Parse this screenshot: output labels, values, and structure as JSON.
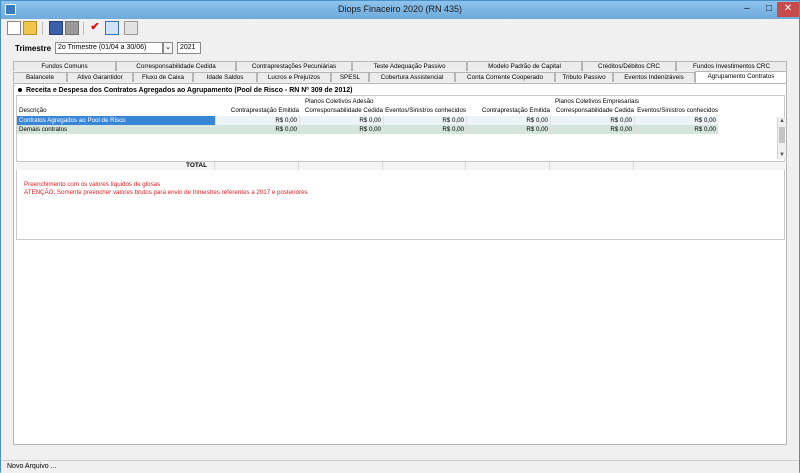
{
  "window": {
    "title": "Diops Finaceiro 2020 (RN 435)",
    "controls": {
      "minimize": "–",
      "maximize": "□",
      "close": "✕"
    }
  },
  "toolbar": {
    "icons": [
      "new-file-icon",
      "open-folder-icon",
      "save-icon",
      "stop-icon",
      "check-icon",
      "export-icon",
      "grid-icon"
    ]
  },
  "filter": {
    "label": "Trimestre",
    "quarter": "2o Trimestre (01/04 a 30/06)",
    "year": "2021"
  },
  "tabs": {
    "row1": [
      "Fundos Comuns",
      "Corresponsabilidade Cedida",
      "Contraprestações Pecuniárias",
      "Teste Adequação Passivo",
      "Modelo Padrão de Capital",
      "Créditos/Débitos CRC",
      "Fundos Investimentos CRC"
    ],
    "row2": [
      "Balancete",
      "Ativo Garantidor",
      "Fluxo de Caixa",
      "Idade Saldos",
      "Lucros e Prejuízos",
      "SPESL",
      "Cobertura Assistencial",
      "Conta Corrente Cooperado",
      "Tributo Passivo",
      "Eventos Indenizáveis",
      "Agrupamento Contratos"
    ],
    "active": "Agrupamento Contratos"
  },
  "section": {
    "title": "Receita e Despesa dos Contratos Agregados ao Agrupamento (Pool de Risco - RN Nº 309 de 2012)"
  },
  "grid": {
    "group_headers": [
      "Planos Coletivos Adesão",
      "Planos Coletivos Empresariais"
    ],
    "columns": [
      "Descrição",
      "Contraprestação Emitida",
      "Corresponsabilidade Cedida",
      "Eventos/Sinistros conhecidos",
      "Contraprestação Emitida",
      "Corresponsabilidade Cedida",
      "Eventos/Sinistros conhecidos"
    ],
    "rows": [
      {
        "desc": "Contratos Agregados ao Pool de Risco",
        "values": [
          "R$ 0,00",
          "R$ 0,00",
          "R$ 0,00",
          "R$ 0,00",
          "R$ 0,00",
          "R$ 0,00"
        ]
      },
      {
        "desc": "Demais contratos",
        "values": [
          "R$ 0,00",
          "R$ 0,00",
          "R$ 0,00",
          "R$ 0,00",
          "R$ 0,00",
          "R$ 0,00"
        ]
      }
    ],
    "total_label": "TOTAL"
  },
  "notes": [
    "Preenchimento com os valores líquidos de glosas",
    "ATENÇÃO: Somente preencher valores brutos para envio de trimestres referentes a  2017 e posteriores"
  ],
  "status": {
    "text": "Novo Arquivo ..."
  }
}
